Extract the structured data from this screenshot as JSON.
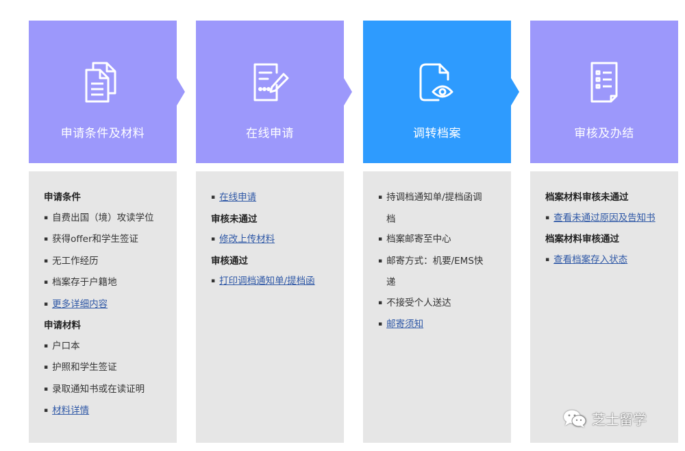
{
  "colors": {
    "step_default": "#9c98fb",
    "step_active": "#2e9bfe",
    "panel_bg": "#e6e6e6",
    "link": "#2f58a6"
  },
  "steps": [
    {
      "title": "申请条件及材料",
      "icon": "documents-icon",
      "active": false
    },
    {
      "title": "在线申请",
      "icon": "edit-form-icon",
      "active": false
    },
    {
      "title": "调转档案",
      "icon": "file-eye-icon",
      "active": true
    },
    {
      "title": "审核及办结",
      "icon": "checklist-icon",
      "active": false
    }
  ],
  "panels": {
    "conditions": {
      "heading1": "申请条件",
      "c1": "自费出国（境）攻读学位",
      "c2": "获得offer和学生签证",
      "c3": "无工作经历",
      "c4": "档案存于户籍地",
      "more_link": "更多详细内容",
      "heading2": "申请材料",
      "m1": "户口本",
      "m2": "护照和学生签证",
      "m3": "录取通知书或在读证明",
      "materials_link": "材料详情"
    },
    "online": {
      "apply_link": "在线申请",
      "heading_fail": "审核未通过",
      "modify_link": "修改上传材料",
      "heading_pass": "审核通过",
      "print_link": "打印调档通知单/提档函"
    },
    "transfer": {
      "i1a": "持调档通知单/提档函调",
      "i1b": "档",
      "i2": "档案邮寄至中心",
      "i3a": "邮寄方式：机要/EMS快",
      "i3b": "递",
      "i4": "不接受个人送达",
      "mail_link": "邮寄须知"
    },
    "review": {
      "heading_fail": "档案材料审核未通过",
      "reason_link": "查看未通过原因及告知书",
      "heading_pass": "档案材料审核通过",
      "status_link": "查看档案存入状态"
    }
  },
  "watermark": {
    "text": "芝士留学",
    "icon": "wechat-icon"
  }
}
